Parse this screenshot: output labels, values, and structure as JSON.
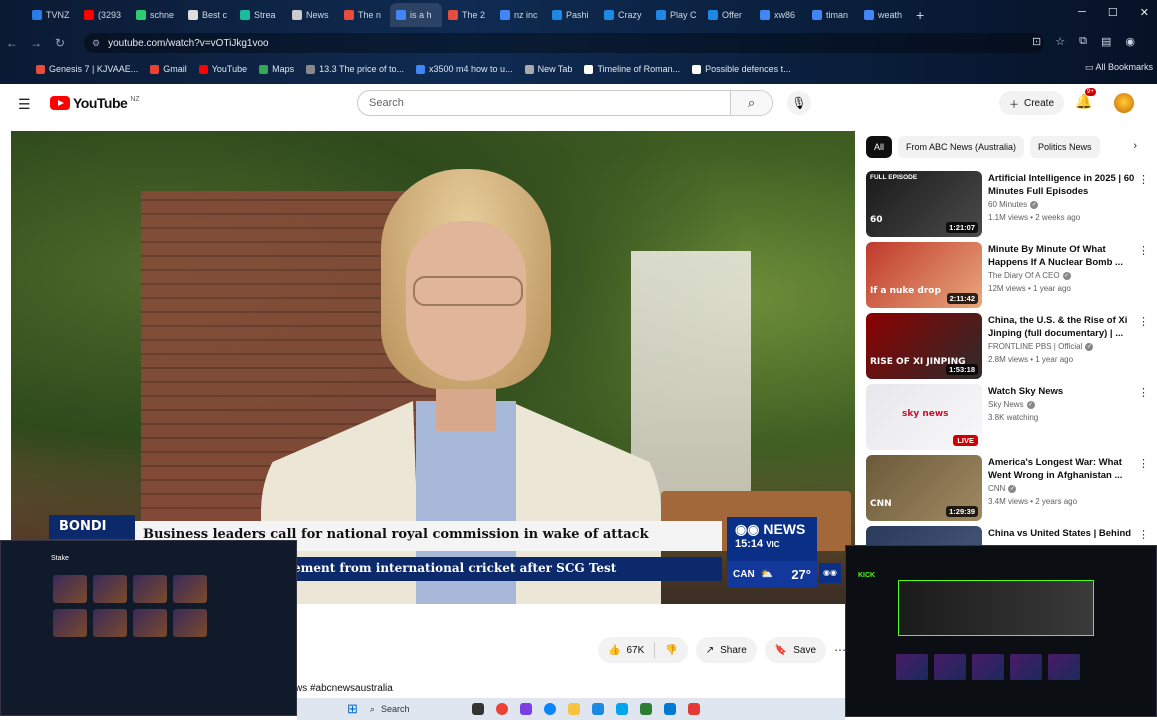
{
  "browser": {
    "tabs": [
      {
        "label": "TVNZ",
        "color": "#2c7be5"
      },
      {
        "label": "(3293",
        "color": "#ff0000"
      },
      {
        "label": "schne",
        "color": "#2ecc71"
      },
      {
        "label": "Best c",
        "color": "#dddddd"
      },
      {
        "label": "Strea",
        "color": "#1abc9c"
      },
      {
        "label": "News",
        "color": "#cccccc"
      },
      {
        "label": "The n",
        "color": "#e74c3c"
      },
      {
        "label": "is a h",
        "color": "#4285f4"
      },
      {
        "label": "The 2",
        "color": "#e74c3c"
      },
      {
        "label": "nz inc",
        "color": "#4285f4"
      },
      {
        "label": "Pashi",
        "color": "#1e88e5"
      },
      {
        "label": "Crazy",
        "color": "#1e88e5"
      },
      {
        "label": "Play C",
        "color": "#1e88e5"
      },
      {
        "label": "Offer",
        "color": "#1e88e5"
      },
      {
        "label": "xw86",
        "color": "#4285f4"
      },
      {
        "label": "timan",
        "color": "#4285f4"
      },
      {
        "label": "weath",
        "color": "#4285f4"
      }
    ],
    "new_tab": "+",
    "url": "youtube.com/watch?v=vOTiJkg1voo",
    "bookmarks": [
      {
        "label": "Genesis 7 | KJVAAE...",
        "color": "#e74c3c"
      },
      {
        "label": "Gmail",
        "color": "#ea4335"
      },
      {
        "label": "YouTube",
        "color": "#ff0000"
      },
      {
        "label": "Maps",
        "color": "#34a853"
      },
      {
        "label": "13.3 The price of to...",
        "color": "#888888"
      },
      {
        "label": "x3500 m4 how to u...",
        "color": "#4285f4"
      },
      {
        "label": "New Tab",
        "color": "#aaaaaa"
      },
      {
        "label": "Timeline of Roman...",
        "color": "#ffffff"
      },
      {
        "label": "Possible defences t...",
        "color": "#ffffff"
      }
    ],
    "all_bookmarks": "All Bookmarks"
  },
  "youtube": {
    "logo_word": "YouTube",
    "country": "NZ",
    "search_placeholder": "Search",
    "create_label": "Create",
    "notif_badge": "9+"
  },
  "video": {
    "chyron_location": "BONDI",
    "headline_primary": "Business leaders call for national royal commission in wake of attack",
    "headline_secondary": "ement from international cricket after SCG Test",
    "news_brand": "NEWS",
    "news_time": "15:14",
    "news_tz": "VIC",
    "weather_city": "CAN",
    "weather_temp": "27°",
    "likes": "67K",
    "share_label": "Share",
    "save_label": "Save",
    "hashtags_fragment": "ws #abcnewsaustralia"
  },
  "sidebar": {
    "chips": [
      "All",
      "From ABC News (Australia)",
      "Politics News"
    ],
    "recommendations": [
      {
        "title": "Artificial Intelligence in 2025 | 60 Minutes Full Episodes",
        "channel": "60 Minutes",
        "stats": "1.1M views • 2 weeks ago",
        "duration": "1:21:07",
        "overlay": "FULL EPISODE",
        "caption": "60",
        "colors": [
          "#1a1a1a",
          "#4a4a4a"
        ]
      },
      {
        "title": "Minute By Minute Of What Happens If A Nuclear Bomb ...",
        "channel": "The Diary Of A CEO",
        "stats": "12M views • 1 year ago",
        "duration": "2:11:42",
        "overlay": "",
        "caption": "If a nuke drop",
        "colors": [
          "#c0392b",
          "#e8a87c"
        ]
      },
      {
        "title": "China, the U.S. & the Rise of Xi Jinping (full documentary) | ...",
        "channel": "FRONTLINE PBS | Official",
        "stats": "2.8M views • 1 year ago",
        "duration": "1:53:18",
        "overlay": "",
        "caption": "RISE OF XI JINPING",
        "colors": [
          "#8b0000",
          "#2c2c2c"
        ]
      },
      {
        "title": "Watch Sky News",
        "channel": "Sky News",
        "stats": "3.8K watching",
        "duration": "LIVE",
        "overlay": "",
        "caption": "sky news",
        "colors": [
          "#e8e8ec",
          "#f8f8fb"
        ]
      },
      {
        "title": "America's Longest War: What Went Wrong in Afghanistan ...",
        "channel": "CNN",
        "stats": "3.4M views • 2 years ago",
        "duration": "1:29:39",
        "overlay": "",
        "caption": "CNN",
        "colors": [
          "#6b5a3a",
          "#a08a62"
        ]
      },
      {
        "title": "China vs United States | Behind",
        "channel": "",
        "stats": "",
        "duration": "",
        "overlay": "",
        "caption": "",
        "colors": [
          "#2a3a5a",
          "#4a5a7a"
        ]
      }
    ]
  },
  "pip_left": {
    "label": "Stake"
  },
  "pip_right": {
    "label": "KICK"
  },
  "taskbar": {
    "search_label": "Search"
  }
}
